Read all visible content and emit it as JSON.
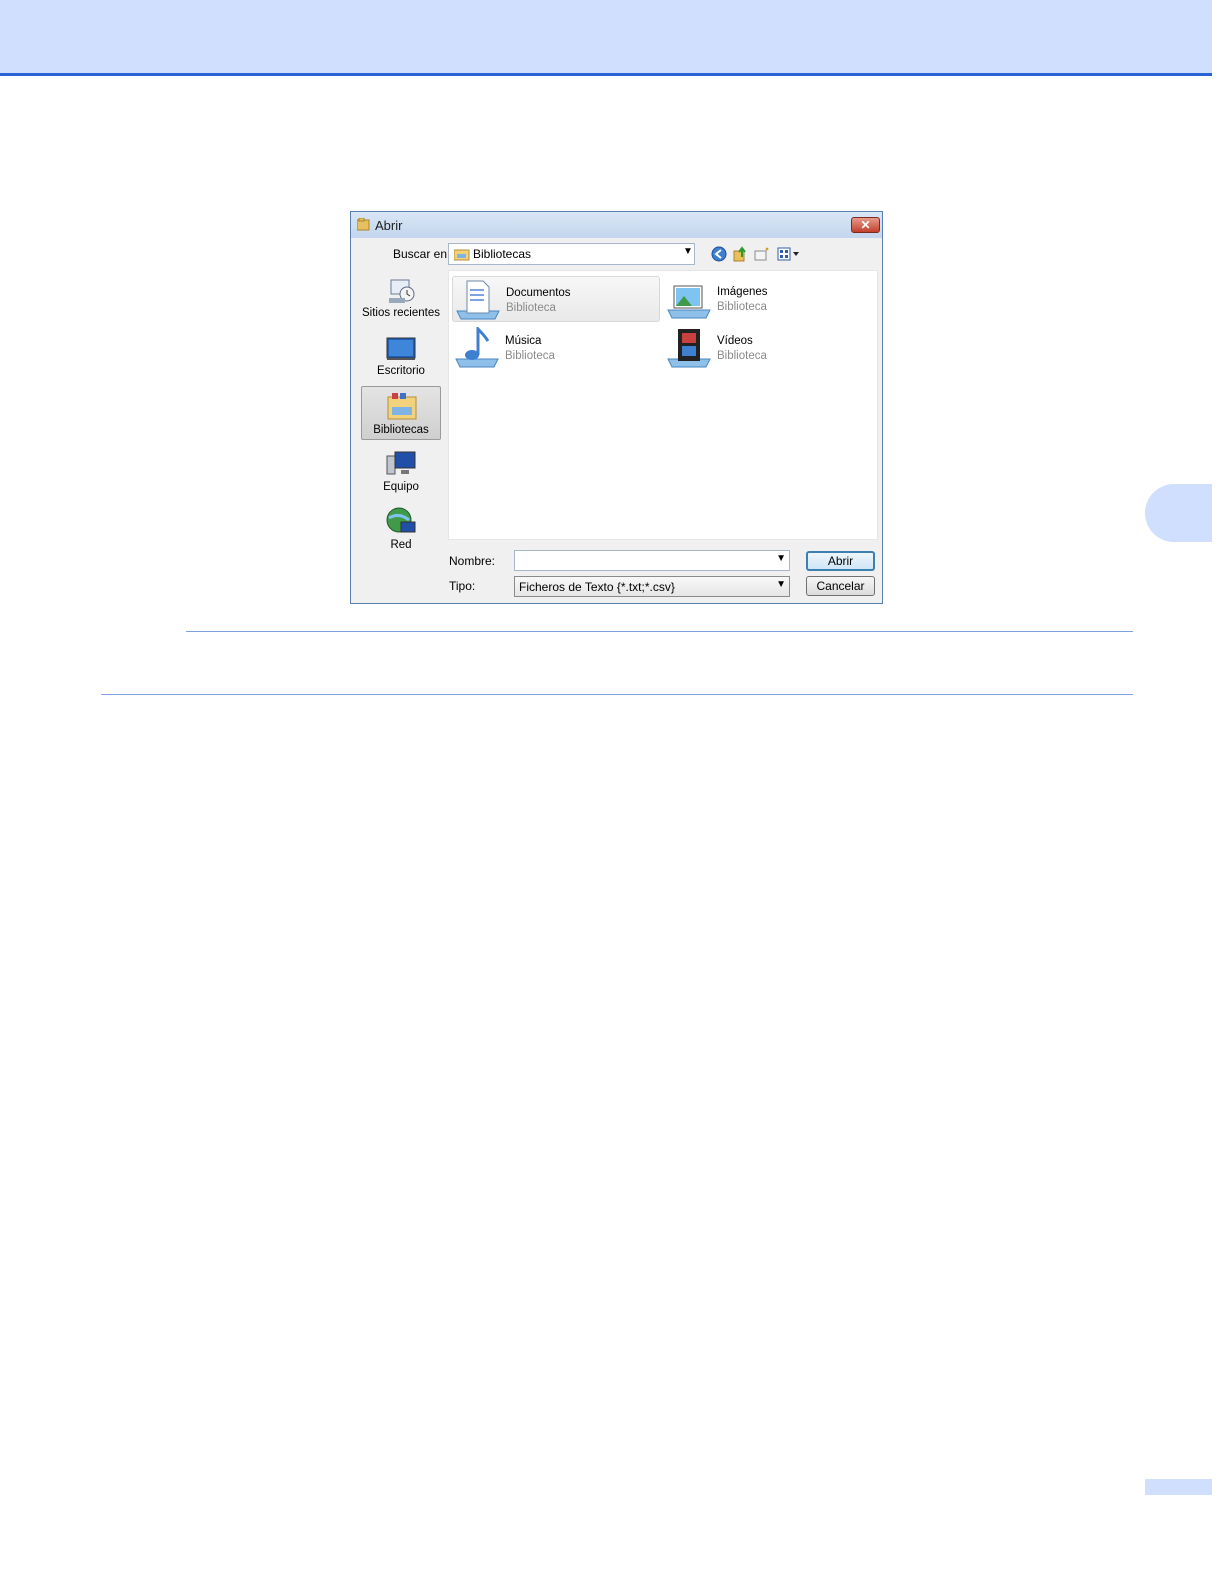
{
  "dialog": {
    "title": "Abrir",
    "close_label": "✕",
    "look_in_label": "Buscar en:",
    "look_in_value": "Bibliotecas",
    "places": [
      {
        "label": "Sitios recientes",
        "icon": "recent-places-icon"
      },
      {
        "label": "Escritorio",
        "icon": "desktop-icon"
      },
      {
        "label": "Bibliotecas",
        "icon": "libraries-icon",
        "selected": true
      },
      {
        "label": "Equipo",
        "icon": "computer-icon"
      },
      {
        "label": "Red",
        "icon": "network-icon"
      }
    ],
    "items": [
      {
        "name": "Documentos",
        "type": "Biblioteca",
        "icon": "documents-library-icon"
      },
      {
        "name": "Imágenes",
        "type": "Biblioteca",
        "icon": "pictures-library-icon"
      },
      {
        "name": "Música",
        "type": "Biblioteca",
        "icon": "music-library-icon"
      },
      {
        "name": "Vídeos",
        "type": "Biblioteca",
        "icon": "videos-library-icon"
      }
    ],
    "file_name_label": "Nombre:",
    "file_name_value": "",
    "file_type_label": "Tipo:",
    "file_type_value": "Ficheros de Texto {*.txt;*.csv}",
    "open_button": "Abrir",
    "cancel_button": "Cancelar",
    "dropdown_arrow": "▼"
  },
  "colors": {
    "page_header": "#cfdffd",
    "page_header_border": "#2a63d6",
    "rule": "#7ea3e0",
    "dialog_bg": "#f0f0f0"
  }
}
